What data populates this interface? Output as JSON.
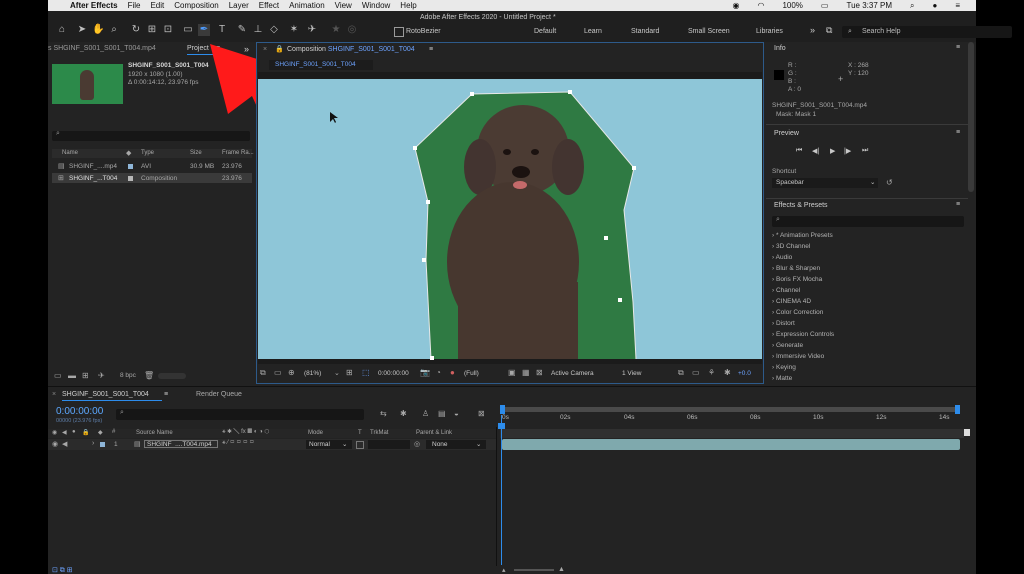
{
  "menubar": {
    "apple": "",
    "app": "After Effects",
    "items": [
      "File",
      "Edit",
      "Composition",
      "Layer",
      "Effect",
      "Animation",
      "View",
      "Window",
      "Help"
    ],
    "battery": "100%",
    "clock": "Tue 3:37 PM"
  },
  "toolbar": {
    "window_title": "Adobe After Effects 2020 - Untitled Project *",
    "rotobezier": "RotoBezier",
    "workspaces": [
      "Default",
      "Learn",
      "Standard",
      "Small Screen",
      "Libraries"
    ],
    "search_help": "Search Help"
  },
  "project": {
    "tab_footage": "s SHGINF_S001_S001_T004.mp4",
    "tab_project": "Project",
    "menu_glyph": "≡",
    "selected_name": "SHGINF_S001_S001_T004",
    "selected_res": "1920 x 1080 (1.00)",
    "selected_dur": "Δ 0:00:14:12, 23.976 fps",
    "columns": [
      "Name",
      "Type",
      "Size",
      "Frame Ra..."
    ],
    "rows": [
      {
        "name": "SHGINF_....mp4",
        "type": "AVI",
        "size": "30.9 MB",
        "rate": "23.976"
      },
      {
        "name": "SHGINF_...T004",
        "type": "Composition",
        "size": "",
        "rate": "23.976"
      }
    ],
    "bpc": "8 bpc"
  },
  "comp": {
    "tab_label": "Composition",
    "tab_name": "SHGINF_S001_S001_T004",
    "subtab": "SHGINF_S001_S001_T004",
    "zoom": "(81%)",
    "timecode": "0:00:00:00",
    "resolution": "(Full)",
    "camera": "Active Camera",
    "view": "1 View",
    "exposure": "+0.0"
  },
  "info": {
    "title": "Info",
    "r": "R :",
    "g": "G :",
    "b": "B :",
    "a": "A :  0",
    "x": "X : 268",
    "y": "Y : 120",
    "file": "SHGINF_S001_S001_T004.mp4",
    "mask": "Mask: Mask 1"
  },
  "preview": {
    "title": "Preview",
    "shortcut": "Shortcut",
    "shortcut_value": "Spacebar"
  },
  "effects": {
    "title": "Effects & Presets",
    "items": [
      "* Animation Presets",
      "3D Channel",
      "Audio",
      "Blur & Sharpen",
      "Boris FX Mocha",
      "Channel",
      "CINEMA 4D",
      "Color Correction",
      "Distort",
      "Expression Controls",
      "Generate",
      "Immersive Video",
      "Keying",
      "Matte"
    ]
  },
  "timeline": {
    "tab": "SHGINF_S001_S001_T004",
    "render_queue": "Render Queue",
    "timecode": "0:00:00:00",
    "frames": "00000 (23.976 fps)",
    "cols": {
      "source": "Source Name",
      "mode": "Mode",
      "t": "T",
      "trkmat": "TrkMat",
      "parent": "Parent & Link"
    },
    "layer": {
      "num": "1",
      "name": "SHGINF_....T004.mp4",
      "mode": "Normal",
      "parent": "None"
    },
    "ruler": [
      "0s",
      "02s",
      "04s",
      "06s",
      "08s",
      "10s",
      "12s",
      "14s"
    ]
  },
  "colors": {
    "accent": "#2d8ceb",
    "screen": "#8ec6d8",
    "greenscreen": "#2f7a43",
    "arrow": "#ff1a1a"
  }
}
